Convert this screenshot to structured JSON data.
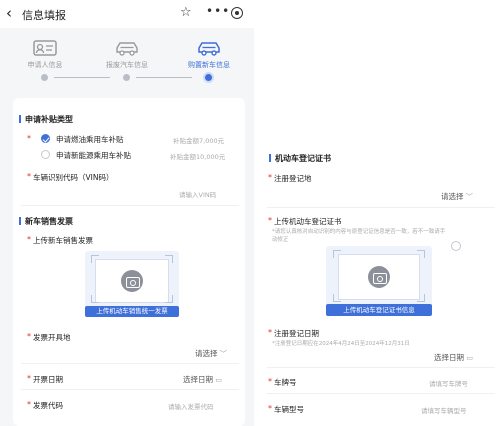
{
  "nav": {
    "back_glyph": "‹",
    "title": "信息填报",
    "star_glyph": "☆",
    "more_glyph": "•••"
  },
  "steps": [
    {
      "label": "申请人信息",
      "icon": "id-card-icon"
    },
    {
      "label": "报废汽车信息",
      "icon": "scrapped-car-icon"
    },
    {
      "label": "购置新车信息",
      "icon": "new-car-icon",
      "active": true
    }
  ],
  "subsidy": {
    "title": "申请补贴类型",
    "options": [
      {
        "label": "申请燃油乘用车补贴",
        "amount": "补贴金额7,000元",
        "checked": true
      },
      {
        "label": "申请新能源乘用车补贴",
        "amount": "补贴金额10,000元",
        "checked": false
      }
    ],
    "vin_label": "车辆识别代码（VIN码）",
    "vin_placeholder": "请输入VIN码"
  },
  "invoice": {
    "title": "新车销售发票",
    "upload_label": "上传新车销售发票",
    "upload_button": "上传机动车销售统一发票",
    "place_label": "发票开具地",
    "place_value": "请选择",
    "date_label": "开票日期",
    "date_value": "选择日期",
    "code_label": "发票代码",
    "code_placeholder": "请输入发票代码"
  },
  "registration": {
    "title": "机动车登记证书",
    "place_label": "注册登记地",
    "place_value": "请选择",
    "upload_label": "上传机动车登记证书",
    "upload_hint_line1": "*请您认真核对自动识别的内容与原登记证信息是否一致，若不一致请手",
    "upload_hint_line2": "动修正",
    "upload_button": "上传机动车登记证书信息",
    "date_label": "注册登记日期",
    "date_hint": "*注册登记日期应在2024年4月24日至2024年12月31日",
    "date_value": "选择日期",
    "plate_label": "车牌号",
    "plate_placeholder": "请填写车牌号",
    "model_label": "车辆型号",
    "model_placeholder": "请填写车辆型号"
  },
  "colors": {
    "accent": "#3f6fd8",
    "required": "#e0302b",
    "background": "#f5f6f8"
  }
}
